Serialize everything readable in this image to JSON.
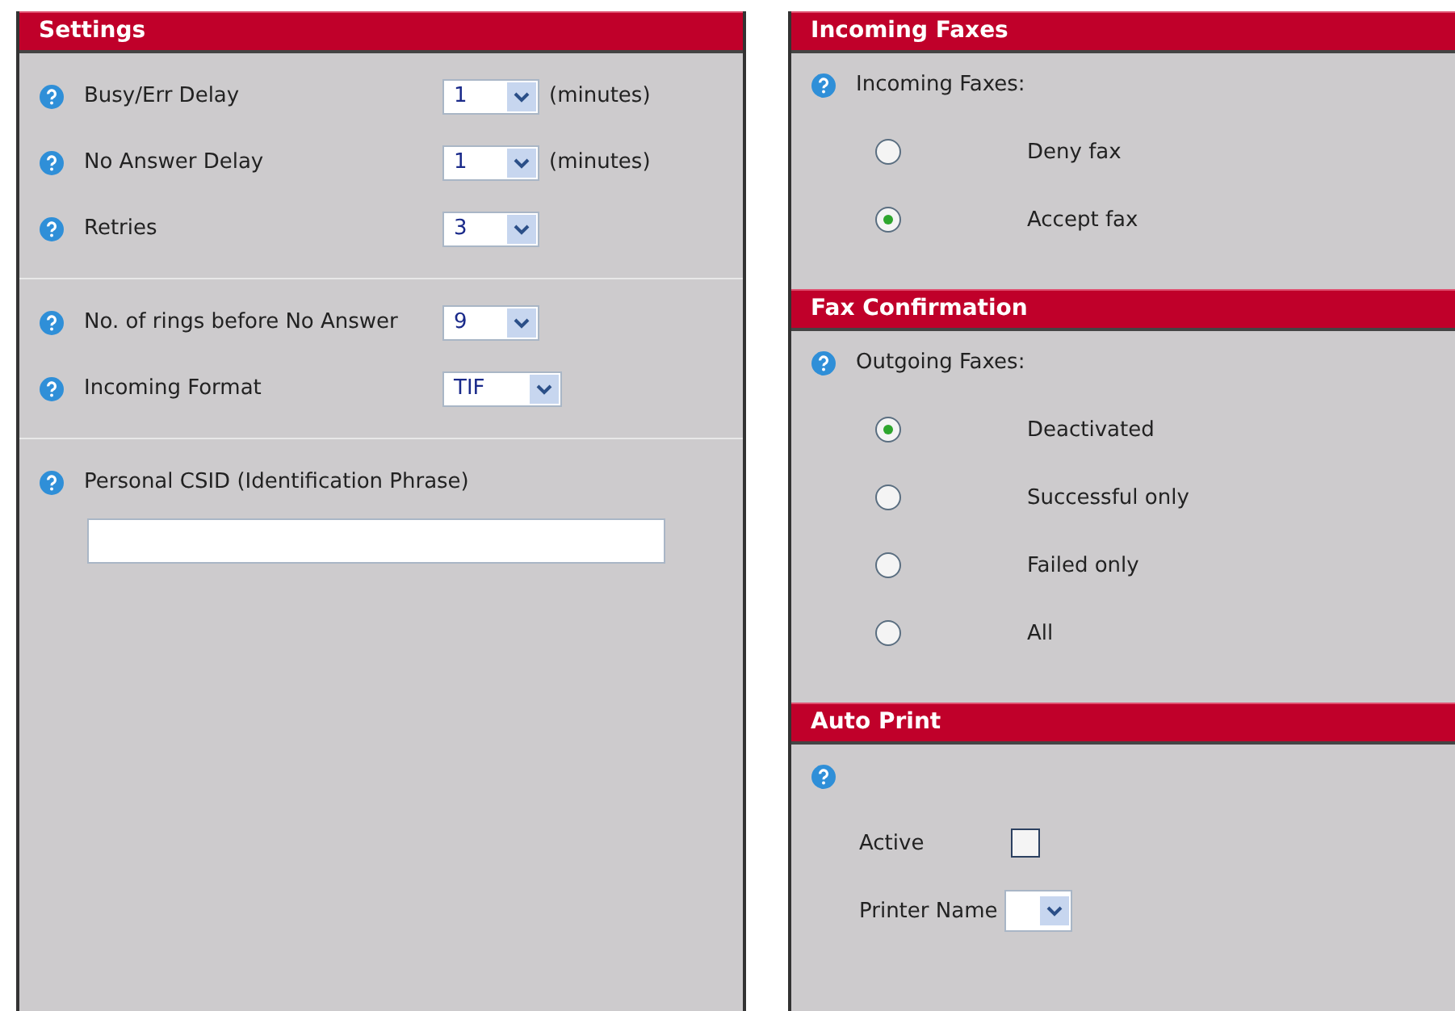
{
  "settings": {
    "title": "Settings",
    "groups": [
      [
        {
          "kind": "select",
          "label": "Busy/Err Delay",
          "value": "1",
          "unit": "(minutes)"
        },
        {
          "kind": "select",
          "label": "No Answer Delay",
          "value": "1",
          "unit": "(minutes)"
        },
        {
          "kind": "select",
          "label": "Retries",
          "value": "3"
        }
      ],
      [
        {
          "kind": "select",
          "label": "No. of rings before No Answer",
          "value": "9"
        },
        {
          "kind": "select",
          "label": "Incoming Format",
          "value": "TIF"
        }
      ],
      [
        {
          "kind": "text",
          "label": "Personal CSID (Identification Phrase)"
        }
      ]
    ]
  },
  "incoming_faxes": {
    "title": "Incoming Faxes",
    "label": "Incoming Faxes:",
    "options": [
      {
        "label": "Deny fax",
        "selected": false
      },
      {
        "label": "Accept fax",
        "selected": true
      }
    ]
  },
  "fax_confirmation": {
    "title": "Fax Confirmation",
    "label": "Outgoing Faxes:",
    "options": [
      {
        "label": "Deactivated",
        "selected": true
      },
      {
        "label": "Successful only",
        "selected": false
      },
      {
        "label": "Failed only",
        "selected": false
      },
      {
        "label": "All",
        "selected": false
      }
    ]
  },
  "auto_print": {
    "title": "Auto Print",
    "fields": [
      {
        "kind": "checkbox",
        "label": "Active",
        "checked": false
      },
      {
        "kind": "select",
        "label": "Printer Name"
      }
    ]
  }
}
